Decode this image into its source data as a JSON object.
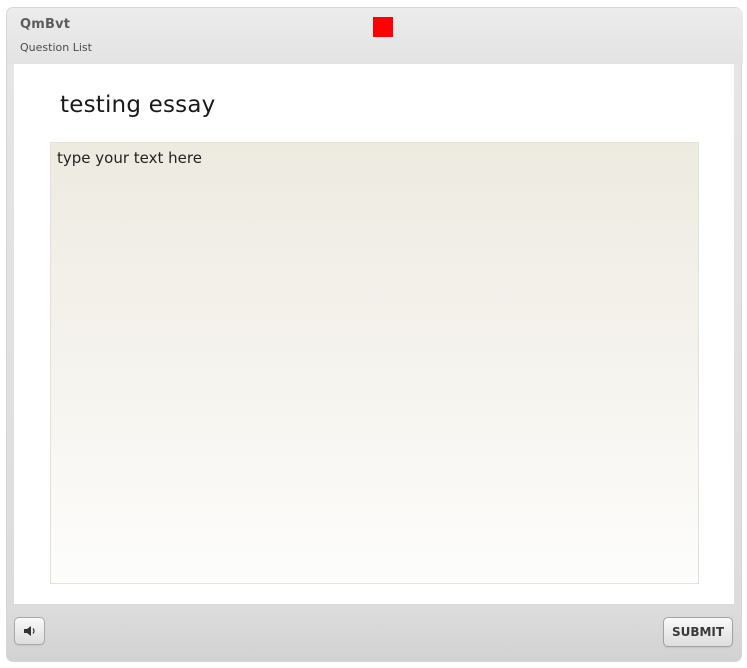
{
  "header": {
    "quiz_title": "QmBvt",
    "question_list_label": "Question List",
    "marker_color": "#ff0000"
  },
  "question": {
    "title": "testing essay",
    "essay_value": "",
    "essay_placeholder": "type your text here"
  },
  "footer": {
    "audio_icon": "speaker-icon",
    "submit_label": "SUBMIT"
  }
}
